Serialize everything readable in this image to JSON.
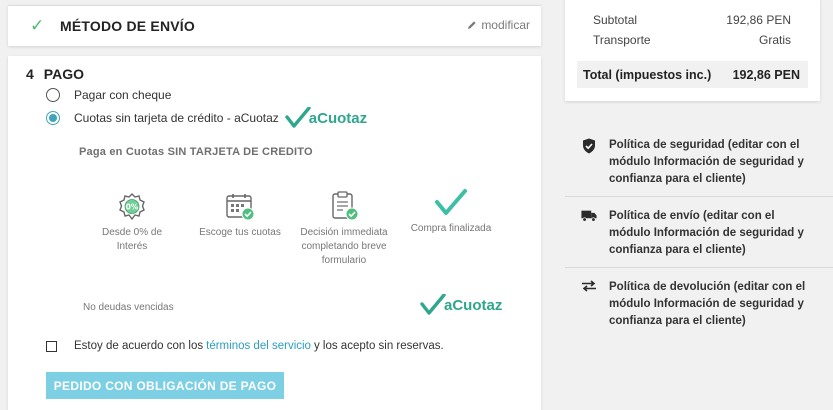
{
  "shipping": {
    "title": "MÉTODO DE ENVÍO",
    "modify_label": "modificar"
  },
  "payment": {
    "step_number": "4",
    "step_title": "PAGO",
    "options": [
      {
        "label": "Pagar con cheque",
        "selected": false
      },
      {
        "label": "Cuotas sin tarjeta de crédito - aCuotaz",
        "selected": true
      }
    ],
    "brand_name": "aCuotaz",
    "promo_title": "Paga en Cuotas SIN TARJETA DE CREDITO",
    "features": [
      {
        "icon": "percent-badge-icon",
        "text": "Desde 0% de Interés"
      },
      {
        "icon": "calendar-check-icon",
        "text": "Escoge tus cuotas"
      },
      {
        "icon": "clipboard-check-icon",
        "text": "Decisión immediata completando breve formulario"
      },
      {
        "icon": "check-mark-icon",
        "text": "Compra finalizada"
      }
    ],
    "no_debt_text": "No deudas vencidas",
    "terms_prefix": "Estoy de acuerdo con los",
    "terms_link": "términos del servicio",
    "terms_suffix": "y los acepto sin reservas.",
    "order_button": "PEDIDO CON OBLIGACIÓN DE PAGO"
  },
  "summary": {
    "subtotal_label": "Subtotal",
    "subtotal_value": "192,86 PEN",
    "shipping_label": "Transporte",
    "shipping_value": "Gratis",
    "total_label": "Total (impuestos inc.)",
    "total_value": "192,86 PEN"
  },
  "reassurance": [
    {
      "icon": "shield-check-icon",
      "text": "Política de seguridad (editar con el módulo Información de seguridad y confianza para el cliente)"
    },
    {
      "icon": "truck-icon",
      "text": "Política de envío (editar con el módulo Información de seguridad y confianza para el cliente)"
    },
    {
      "icon": "exchange-arrows-icon",
      "text": "Política de devolución (editar con el módulo Información de seguridad y confianza para el cliente)"
    }
  ],
  "colors": {
    "accent": "#3ea6b8",
    "brand_green": "#2fa68e",
    "button_disabled": "#7dcfe3",
    "link": "#2a9fc0"
  }
}
